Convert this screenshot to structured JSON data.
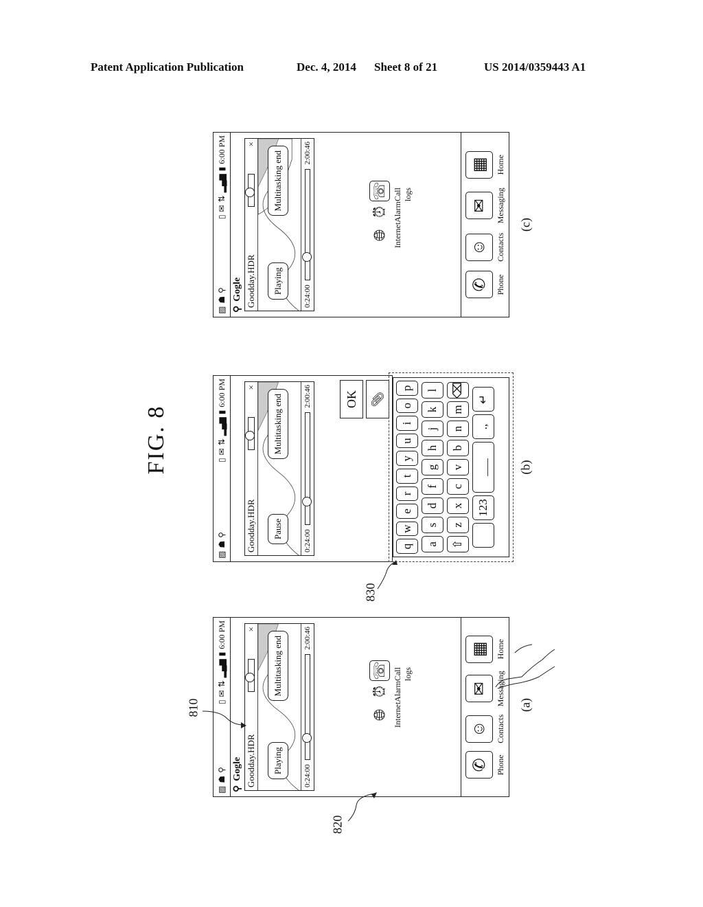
{
  "header": {
    "left": "Patent Application Publication",
    "date": "Dec. 4, 2014",
    "sheet": "Sheet 8 of 21",
    "number": "US 2014/0359443 A1"
  },
  "figure": {
    "title": "FIG. 8",
    "labels": {
      "a": "(a)",
      "b": "(b)",
      "c": "(c)"
    },
    "refs": {
      "r810": "810",
      "r820": "820",
      "r830": "830"
    }
  },
  "phone": {
    "time": "6:00 PM",
    "search_label": "Gogle",
    "video_title": "Goodday.HDR",
    "multitask_label": "Multitasking end",
    "time_start": "0:24:00",
    "time_end": "2:00:46",
    "close_glyph": "×",
    "volume_level": 0.3,
    "seek_progress": 0.2,
    "status_icons": [
      "photo-icon",
      "android-icon",
      "usb-icon",
      "sd-card-icon",
      "sms-icon",
      "network-icon",
      "signal-icon",
      "battery-icon"
    ]
  },
  "panel_a": {
    "play_label": "Playing"
  },
  "panel_b": {
    "play_label": "Pause",
    "ok_label": "OK"
  },
  "panel_c": {
    "play_label": "Playing"
  },
  "apps": {
    "row": [
      {
        "label": "Internet",
        "icon": "globe-icon"
      },
      {
        "label": "Alarm",
        "icon": "alarm-clock-icon"
      },
      {
        "label": "Call logs",
        "icon": "call-log-icon"
      }
    ],
    "dock": [
      {
        "label": "Phone",
        "icon": "phone-handset-icon"
      },
      {
        "label": "Contacts",
        "icon": "contacts-icon"
      },
      {
        "label": "Messaging",
        "icon": "envelope-icon"
      },
      {
        "label": "Home",
        "icon": "grid-icon"
      }
    ]
  },
  "keyboard": {
    "row1": [
      "q",
      "w",
      "e",
      "r",
      "t",
      "y",
      "u",
      "i",
      "o",
      "p"
    ],
    "row2": [
      "a",
      "s",
      "d",
      "f",
      "g",
      "h",
      "j",
      "k",
      "l"
    ],
    "row3": [
      "⇧",
      "z",
      "x",
      "c",
      "v",
      "b",
      "n",
      "m",
      "⌫"
    ],
    "row4": [
      "",
      "123",
      "___",
      ".,",
      "↵"
    ]
  }
}
